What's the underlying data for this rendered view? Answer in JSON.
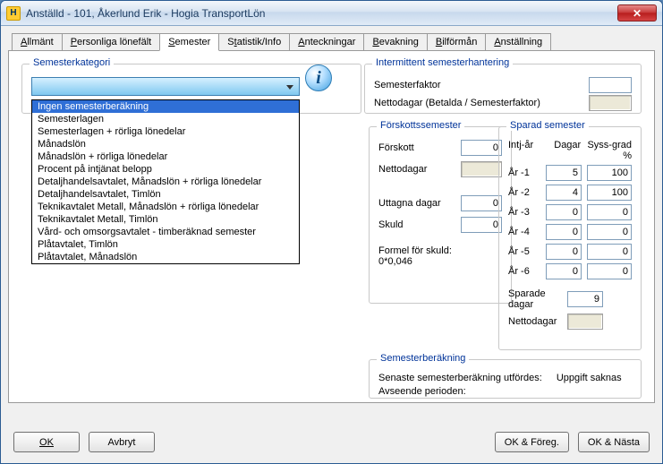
{
  "window": {
    "title": "Anställd - 101, Åkerlund Erik - Hogia TransportLön",
    "app_icon_letter": "H"
  },
  "tabs": [
    "Allmänt",
    "Personliga lönefält",
    "Semester",
    "Statistik/Info",
    "Anteckningar",
    "Bevakning",
    "Bilförmån",
    "Anställning"
  ],
  "active_tab_index": 2,
  "groups": {
    "kategori": {
      "legend": "Semesterkategori"
    },
    "intermittent": {
      "legend": "Intermittent semesterhantering",
      "row1_label": "Semesterfaktor",
      "row2_label": "Nettodagar (Betalda / Semesterfaktor)",
      "semfaktor_value": "",
      "nettodagar_value": ""
    },
    "forskott": {
      "legend": "Förskottssemester",
      "rows": {
        "forskott_label": "Förskott",
        "forskott_value": "0",
        "nettodagar_label": "Nettodagar",
        "nettodagar_value": "",
        "uttagna_label": "Uttagna dagar",
        "uttagna_value": "0",
        "skuld_label": "Skuld",
        "skuld_value": "0",
        "formel_label": "Formel för skuld:",
        "formel_value": "0*0,046"
      }
    },
    "sparad": {
      "legend": "Sparad semester",
      "head_intjar": "Intj-år",
      "head_dagar": "Dagar",
      "head_syss": "Syss-grad %",
      "years": [
        {
          "label": "År -1",
          "dagar": "5",
          "syss": "100"
        },
        {
          "label": "År -2",
          "dagar": "4",
          "syss": "100"
        },
        {
          "label": "År -3",
          "dagar": "0",
          "syss": "0"
        },
        {
          "label": "År -4",
          "dagar": "0",
          "syss": "0"
        },
        {
          "label": "År -5",
          "dagar": "0",
          "syss": "0"
        },
        {
          "label": "År -6",
          "dagar": "0",
          "syss": "0"
        }
      ],
      "sparade_label": "Sparade dagar",
      "sparade_value": "9",
      "nettodagar_label": "Nettodagar",
      "nettodagar_value": ""
    },
    "calc": {
      "legend": "Semesterberäkning",
      "row1_label": "Senaste semesterberäkning utfördes:",
      "row1_value": "Uppgift saknas",
      "row2_label": "Avseende perioden:"
    }
  },
  "dropdown_options": [
    "Ingen semesterberäkning",
    "Semesterlagen",
    "Semesterlagen + rörliga lönedelar",
    "Månadslön",
    "Månadslön + rörliga lönedelar",
    "Procent på intjänat belopp",
    "Detaljhandelsavtalet, Månadslön + rörliga lönedelar",
    "Detaljhandelsavtalet, Timlön",
    "Teknikavtalet Metall, Månadslön + rörliga lönedelar",
    "Teknikavtalet Metall, Timlön",
    "Vård- och omsorgsavtalet - timberäknad semester",
    "Plåtavtalet, Timlön",
    "Plåtavtalet, Månadslön"
  ],
  "dropdown_highlight_index": 0,
  "buttons": {
    "ok": "OK",
    "avbryt": "Avbryt",
    "ok_foreg": "OK & Föreg.",
    "ok_nasta": "OK & Nästa"
  }
}
